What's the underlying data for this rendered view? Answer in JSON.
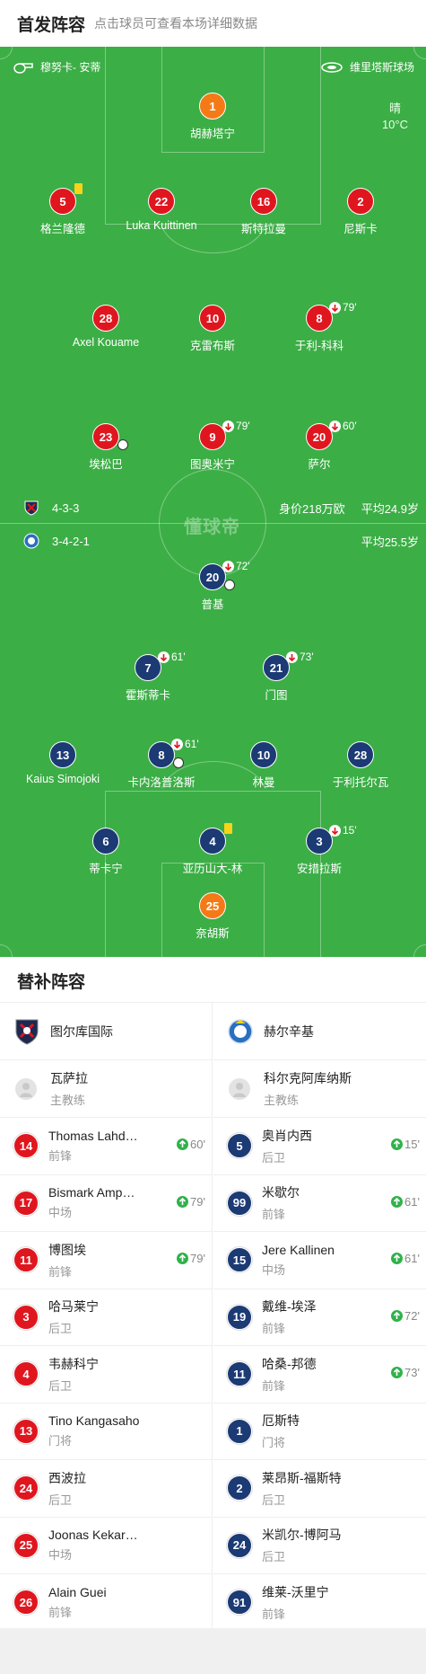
{
  "header": {
    "title": "首发阵容",
    "subtitle": "点击球员可查看本场详细数据"
  },
  "pitch": {
    "referee": "穆努卡- 安蒂",
    "stadium": "维里塔斯球场",
    "weather": "晴",
    "temperature": "10°C",
    "watermark": "懂球帝",
    "home_formation": "4-3-3",
    "home_value": "身价218万欧",
    "home_avg_age": "平均24.9岁",
    "away_formation": "3-4-2-1",
    "away_avg_age": "平均25.5岁",
    "colors": {
      "grass": "#3cae46",
      "home": "#e0161f",
      "away": "#1c3a74",
      "keeper": "#f47a17",
      "card": "#f8d31a"
    }
  },
  "home_players": [
    {
      "num": "1",
      "name": "胡赫塔宁",
      "gk": true
    },
    {
      "num": "5",
      "name": "格兰隆德",
      "card": true
    },
    {
      "num": "22",
      "name": "Luka Kuittinen"
    },
    {
      "num": "16",
      "name": "斯特拉曼"
    },
    {
      "num": "2",
      "name": "尼斯卡"
    },
    {
      "num": "28",
      "name": "Axel Kouame"
    },
    {
      "num": "10",
      "name": "克雷布斯"
    },
    {
      "num": "8",
      "name": "于利-科科",
      "sub": "79'"
    },
    {
      "num": "23",
      "name": "埃松巴",
      "goal": true
    },
    {
      "num": "9",
      "name": "图奥米宁",
      "sub": "79'"
    },
    {
      "num": "20",
      "name": "萨尔",
      "sub": "60'"
    }
  ],
  "away_players": [
    {
      "num": "20",
      "name": "普基",
      "sub": "72'",
      "goal": true
    },
    {
      "num": "7",
      "name": "霍斯蒂卡",
      "sub": "61'"
    },
    {
      "num": "21",
      "name": "门图",
      "sub": "73'"
    },
    {
      "num": "13",
      "name": "Kaius Simojoki"
    },
    {
      "num": "8",
      "name": "卡内洛普洛斯",
      "sub": "61'",
      "goal": true
    },
    {
      "num": "10",
      "name": "林曼"
    },
    {
      "num": "28",
      "name": "于利托尔瓦"
    },
    {
      "num": "6",
      "name": "蒂卡宁"
    },
    {
      "num": "4",
      "name": "亚历山大-林",
      "card": true
    },
    {
      "num": "3",
      "name": "安措拉斯",
      "sub": "15'"
    },
    {
      "num": "25",
      "name": "奈胡斯",
      "gk": true
    }
  ],
  "subs": {
    "title": "替补阵容",
    "home": {
      "team": "图尔库国际",
      "coach": {
        "name": "瓦萨拉",
        "role": "主教练"
      },
      "players": [
        {
          "num": "14",
          "name": "Thomas Lahd…",
          "pos": "前锋",
          "in": "60'"
        },
        {
          "num": "17",
          "name": "Bismark Amp…",
          "pos": "中场",
          "in": "79'"
        },
        {
          "num": "11",
          "name": "博图埃",
          "pos": "前锋",
          "in": "79'"
        },
        {
          "num": "3",
          "name": "哈马莱宁",
          "pos": "后卫"
        },
        {
          "num": "4",
          "name": "韦赫科宁",
          "pos": "后卫"
        },
        {
          "num": "13",
          "name": "Tino Kangasaho",
          "pos": "门将"
        },
        {
          "num": "24",
          "name": "西波拉",
          "pos": "后卫"
        },
        {
          "num": "25",
          "name": "Joonas Kekar…",
          "pos": "中场"
        },
        {
          "num": "26",
          "name": "Alain Guei",
          "pos": "前锋"
        }
      ]
    },
    "away": {
      "team": "赫尔辛基",
      "coach": {
        "name": "科尔克阿库纳斯",
        "role": "主教练"
      },
      "players": [
        {
          "num": "5",
          "name": "奥肖内西",
          "pos": "后卫",
          "in": "15'"
        },
        {
          "num": "99",
          "name": "米歇尔",
          "pos": "前锋",
          "in": "61'"
        },
        {
          "num": "15",
          "name": "Jere Kallinen",
          "pos": "中场",
          "in": "61'"
        },
        {
          "num": "19",
          "name": "戴维-埃泽",
          "pos": "前锋",
          "in": "72'"
        },
        {
          "num": "11",
          "name": "哈桑-邦德",
          "pos": "前锋",
          "in": "73'"
        },
        {
          "num": "1",
          "name": "厄斯特",
          "pos": "门将"
        },
        {
          "num": "2",
          "name": "莱昂斯-福斯特",
          "pos": "后卫"
        },
        {
          "num": "24",
          "name": "米凯尔-博阿马",
          "pos": "后卫"
        },
        {
          "num": "91",
          "name": "维莱-沃里宁",
          "pos": "前锋"
        }
      ]
    }
  }
}
